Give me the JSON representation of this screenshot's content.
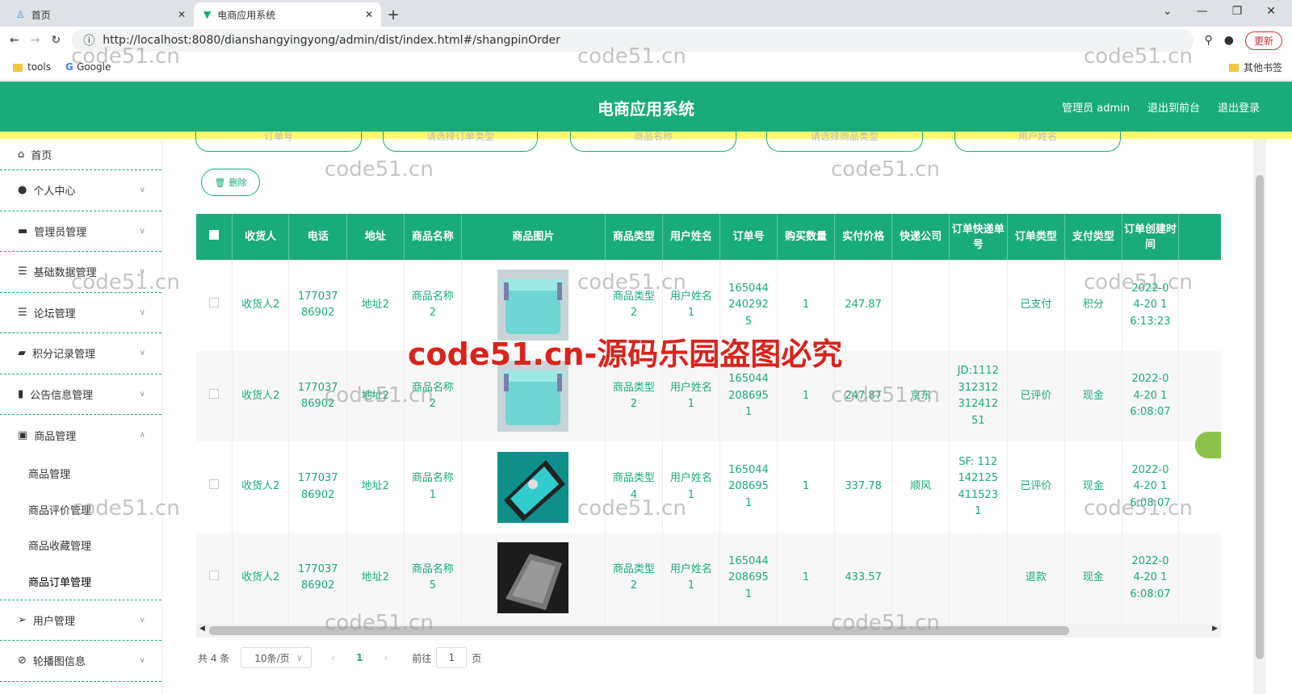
{
  "browser": {
    "tabs": [
      {
        "label": "首页"
      },
      {
        "label": "电商应用系统"
      }
    ],
    "url": "http://localhost:8080/dianshangyingyong/admin/dist/index.html#/shangpinOrder",
    "update_label": "更新",
    "bookmarks": [
      "tools",
      "Google"
    ],
    "other_bookmarks": "其他书签"
  },
  "header": {
    "title": "电商应用系统",
    "user": "管理员 admin",
    "to_front": "退出到前台",
    "logout": "退出登录"
  },
  "sidebar": {
    "items": [
      {
        "label": "首页",
        "icon": "home-icon"
      },
      {
        "label": "个人中心",
        "icon": "user-icon"
      },
      {
        "label": "管理员管理",
        "icon": "briefcase-icon"
      },
      {
        "label": "基础数据管理",
        "icon": "list-icon"
      },
      {
        "label": "论坛管理",
        "icon": "list-icon"
      },
      {
        "label": "积分记录管理",
        "icon": "ticket-icon"
      },
      {
        "label": "公告信息管理",
        "icon": "chart-icon"
      },
      {
        "label": "商品管理",
        "icon": "clipboard-icon"
      }
    ],
    "sub": [
      "商品管理",
      "商品评价管理",
      "商品收藏管理",
      "商品订单管理"
    ],
    "items2": [
      {
        "label": "用户管理",
        "icon": "send-icon"
      },
      {
        "label": "轮播图信息",
        "icon": "compass-icon"
      }
    ]
  },
  "search": {
    "order_no": "订单号",
    "order_type": "请选择订单类型",
    "goods_name": "商品名称",
    "goods_type": "请选择商品类型",
    "user_name": "用户姓名"
  },
  "delete_label": "删除",
  "table": {
    "headers": [
      "收货人",
      "电话",
      "地址",
      "商品名称",
      "商品图片",
      "商品类型",
      "用户姓名",
      "订单号",
      "购买数量",
      "实付价格",
      "快递公司",
      "订单快递单号",
      "订单类型",
      "支付类型",
      "订单创建时间",
      ""
    ],
    "rows": [
      [
        "收货人2",
        "17703786902",
        "地址2",
        "商品名称2",
        "box",
        "商品类型2",
        "用户姓名1",
        "1650442402925",
        "1",
        "247.87",
        "",
        "",
        "已支付",
        "积分",
        "2022-04-20 16:13:23"
      ],
      [
        "收货人2",
        "17703786902",
        "地址2",
        "商品名称2",
        "box",
        "商品类型2",
        "用户姓名1",
        "1650442086951",
        "1",
        "247.87",
        "京东",
        "JD:111231231231241251",
        "已评价",
        "现金",
        "2022-04-20 16:08:07"
      ],
      [
        "收货人2",
        "17703786902",
        "地址2",
        "商品名称1",
        "laptop-teal",
        "商品类型4",
        "用户姓名1",
        "1650442086951",
        "1",
        "337.78",
        "顺风",
        "SF: 1121421254115231",
        "已评价",
        "现金",
        "2022-04-20 16:08:07"
      ],
      [
        "收货人2",
        "17703786902",
        "地址2",
        "商品名称5",
        "laptop-dark",
        "商品类型2",
        "用户姓名1",
        "1650442086951",
        "1",
        "433.57",
        "",
        "",
        "退款",
        "现金",
        "2022-04-20 16:08:07"
      ]
    ]
  },
  "pager": {
    "total": "共 4 条",
    "page_size": "10条/页",
    "current": "1",
    "goto": "前往",
    "goto_value": "1",
    "page_unit": "页"
  },
  "watermark": "code51.cn",
  "watermark_big": "code51.cn-源码乐园盗图必究"
}
